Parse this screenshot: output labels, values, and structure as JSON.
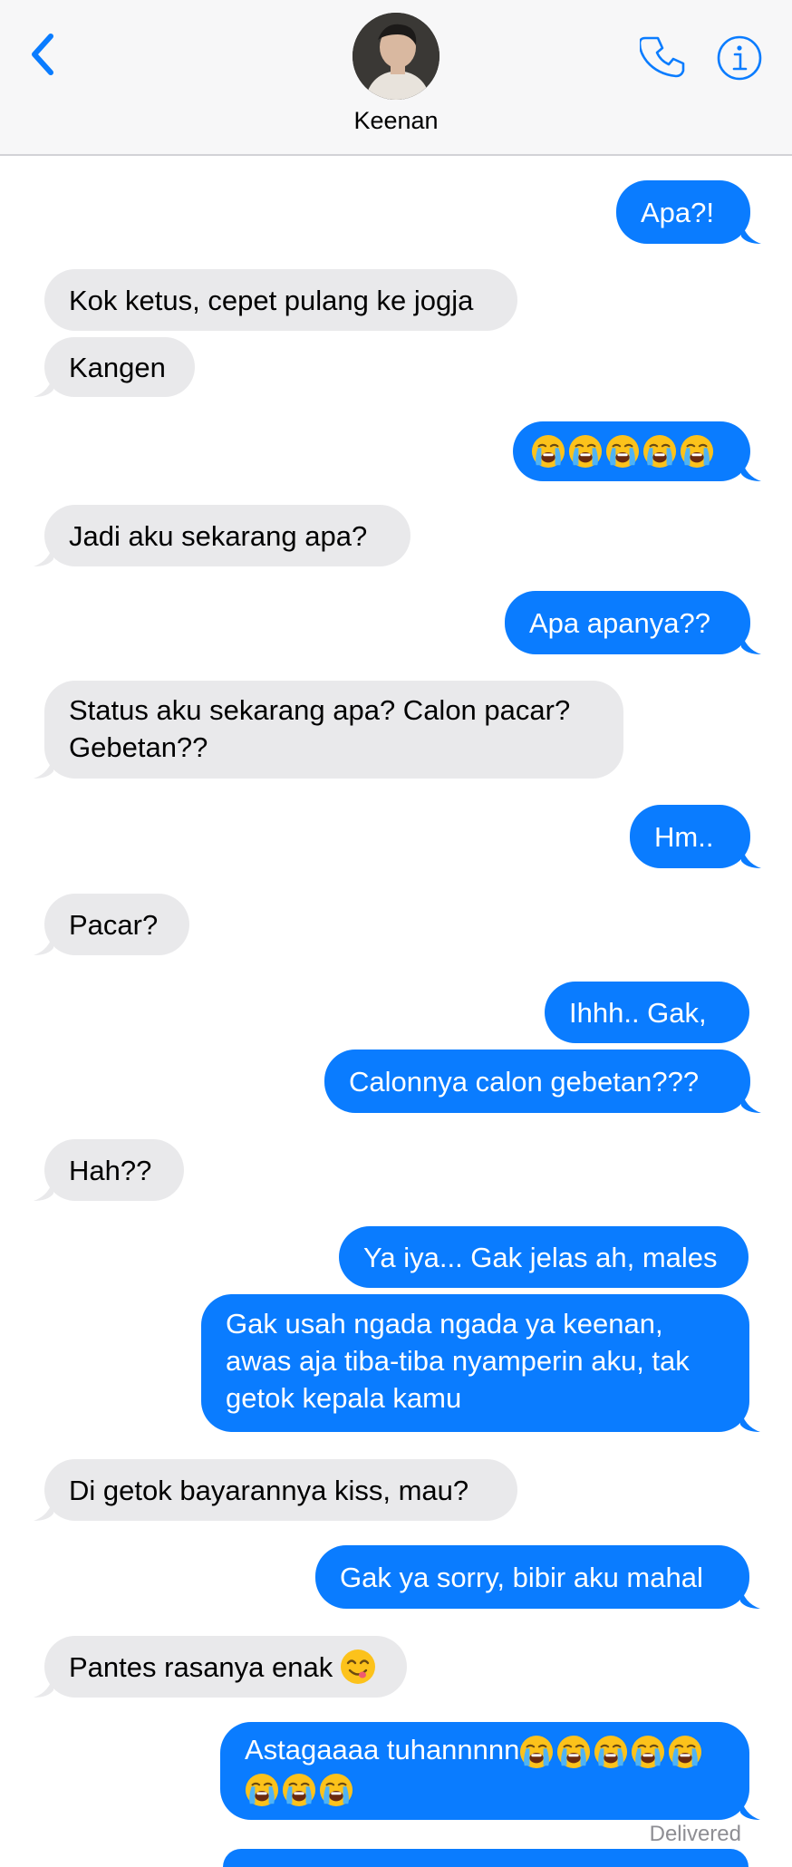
{
  "header": {
    "contact_name": "Keenan",
    "back_icon": "chevron-left-icon",
    "call_icon": "phone-icon",
    "info_icon": "info-icon",
    "accent_color": "#0a7cff"
  },
  "messages": [
    {
      "side": "sent",
      "text": "Apa?!"
    },
    {
      "side": "recv",
      "text": "Kok ketus, cepet pulang ke jogja"
    },
    {
      "side": "recv",
      "text": "Kangen"
    },
    {
      "side": "sent",
      "text": "",
      "emoji": "loudly-crying-face",
      "emoji_count": 5
    },
    {
      "side": "recv",
      "text": "Jadi aku sekarang apa?"
    },
    {
      "side": "sent",
      "text": "Apa apanya??"
    },
    {
      "side": "recv",
      "text": "Status aku sekarang apa? Calon pacar? Gebetan??"
    },
    {
      "side": "sent",
      "text": "Hm.."
    },
    {
      "side": "recv",
      "text": "Pacar?"
    },
    {
      "side": "sent",
      "text": "Ihhh..  Gak,"
    },
    {
      "side": "sent",
      "text": "Calonnya calon gebetan???"
    },
    {
      "side": "recv",
      "text": "Hah??"
    },
    {
      "side": "sent",
      "text": "Ya iya... Gak jelas ah, males"
    },
    {
      "side": "sent",
      "text": "Gak usah ngada ngada ya keenan, awas aja tiba-tiba nyamperin aku, tak getok kepala kamu"
    },
    {
      "side": "recv",
      "text": "Di getok bayarannya kiss, mau?"
    },
    {
      "side": "sent",
      "text": "Gak ya sorry, bibir aku mahal"
    },
    {
      "side": "recv",
      "text": "Pantes rasanya enak",
      "emoji": "savoring-food-face",
      "emoji_count": 1
    },
    {
      "side": "sent",
      "text": "Astagaaaa tuhannnnn",
      "emoji": "loudly-crying-face",
      "emoji_count": 8
    }
  ],
  "status": {
    "delivered": "Delivered"
  }
}
